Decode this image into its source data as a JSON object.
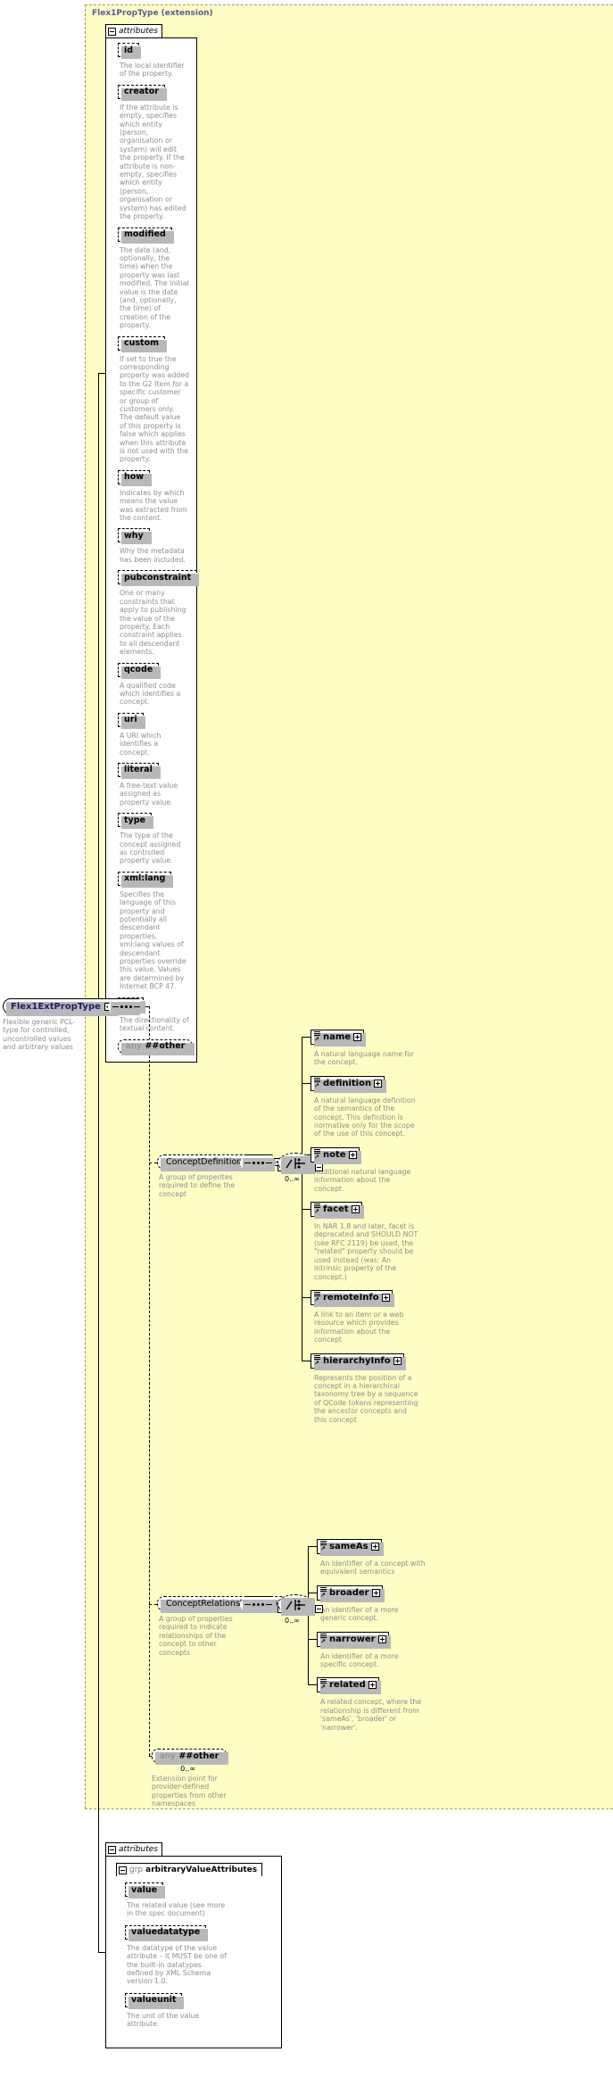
{
  "diagram": {
    "title": "Flex1PropType (extension)",
    "root": {
      "name": "Flex1ExtPropType",
      "description": "Flexible generic PCL-type for controlled, uncontrolled values and arbitrary values"
    },
    "attributes_label": "attributes",
    "group_keyword": "grp",
    "any_keyword": "any",
    "any_namespace": "##other",
    "cardinality_unbounded": "0..∞"
  },
  "extension_attributes": [
    {
      "name": "id",
      "description": "The local identifier of the property."
    },
    {
      "name": "creator",
      "description": "If the attribute is empty, specifies which entity (person, organisation or system) will edit the property. If the attribute is non-empty, specifies which entity (person, organisation or system) has edited the property."
    },
    {
      "name": "modified",
      "description": "The date (and, optionally, the time) when the property was last modified. The initial value is the date (and, optionally, the time) of creation of the property."
    },
    {
      "name": "custom",
      "description": "If set to true the corresponding property was added to the G2 Item for a specific customer or group of customers only. The default value of this property is false which applies when this attribute is not used with the property."
    },
    {
      "name": "how",
      "description": "Indicates by which means the value was extracted from the content."
    },
    {
      "name": "why",
      "description": "Why the metadata has been included."
    },
    {
      "name": "pubconstraint",
      "description": "One or many constraints that apply to publishing the value of the property. Each constraint applies to all descendant elements."
    },
    {
      "name": "qcode",
      "description": "A qualified code which identifies a concept."
    },
    {
      "name": "uri",
      "description": "A URI which identifies a concept."
    },
    {
      "name": "literal",
      "description": "A free-text value assigned as property value."
    },
    {
      "name": "type",
      "description": "The type of the concept assigned as controlled property value."
    },
    {
      "name": "xml:lang",
      "description": "Specifies the language of this property and potentially all descendant properties. xml:lang values of descendant properties override this value. Values are determined by Internet BCP 47."
    },
    {
      "name": "dir",
      "description": "The directionality of textual content."
    }
  ],
  "concept_definition_group": {
    "name": "ConceptDefinitionGroup",
    "description": "A group of properites required to define the concept",
    "cardinality": "0..∞",
    "elements": [
      {
        "name": "name",
        "description": "A natural language name for the concept."
      },
      {
        "name": "definition",
        "description": "A natural language definition of the semantics of the concept. This definition is normative only for the scope of the use of this concept."
      },
      {
        "name": "note",
        "description": "Additional natural language information about the concept."
      },
      {
        "name": "facet",
        "description": "In NAR 1.8 and later, facet is deprecated and SHOULD NOT (see RFC 2119) be used, the \"related\" property should be used instead (was: An intrinsic property of the concept.)"
      },
      {
        "name": "remoteInfo",
        "description": "A link to an item or a web resource which provides information about the concept"
      },
      {
        "name": "hierarchyInfo",
        "description": "Represents the position of a concept in a hierarchical taxonomy tree by a sequence of QCode tokens representing the ancestor concepts and this concept"
      }
    ]
  },
  "concept_relationships_group": {
    "name": "ConceptRelationshipsGroup",
    "description": "A group of properties required to indicate relationships of the concept to other concepts",
    "cardinality": "0..∞",
    "elements": [
      {
        "name": "sameAs",
        "description": "An identifier of a concept with equivalent semantics"
      },
      {
        "name": "broader",
        "description": "An identifier of a more generic concept."
      },
      {
        "name": "narrower",
        "description": "An identifier of a more specific concept."
      },
      {
        "name": "related",
        "description": "A related concept, where the relationship is different from 'sameAs', 'broader' or 'narrower'."
      }
    ]
  },
  "extension_point": {
    "keyword": "any",
    "namespace": "##other",
    "cardinality": "0..∞",
    "description": "Extension point for provider-defined properties from other namespaces"
  },
  "base_attributes": {
    "label": "attributes",
    "group": {
      "keyword": "grp",
      "name": "arbitraryValueAttributes",
      "attributes": [
        {
          "name": "value",
          "description": "The related value (see more in the spec document)"
        },
        {
          "name": "valuedatatype",
          "description": "The datatype of the value attribute – it MUST be one of the built-in datatypes defined by XML Schema version 1.0."
        },
        {
          "name": "valueunit",
          "description": "The unit of the value attribute."
        }
      ]
    }
  },
  "colors": {
    "extension_background": "#fdfdc4",
    "extension_border": "#9a9a6a",
    "title_text": "#5a5a9a",
    "description_text": "#8d8d8d",
    "node_border": "#000000",
    "type_name_text": "#1b1b6e"
  }
}
